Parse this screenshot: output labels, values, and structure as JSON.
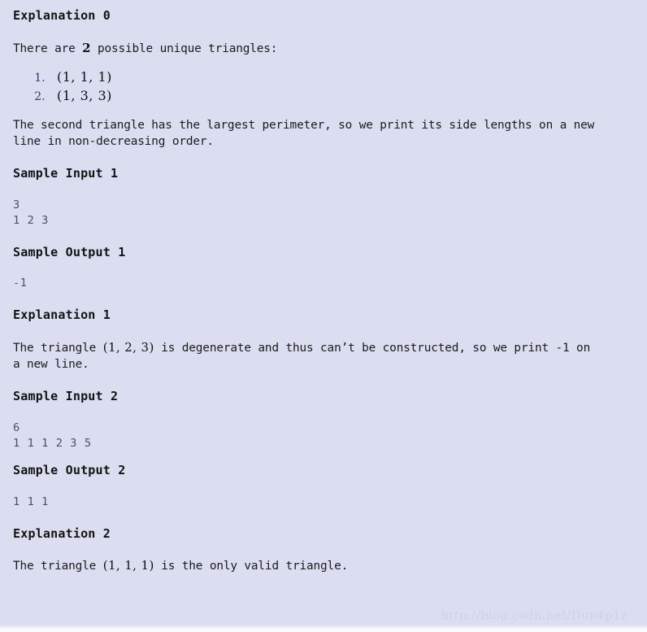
{
  "page": {
    "background_color": "#dbdef0",
    "text_color": "#1b1b1b",
    "code_color": "#4a4f63",
    "watermark_color": "#cfd2e4"
  },
  "sections": {
    "explanation0": {
      "heading": "Explanation 0",
      "intro_before": "There are ",
      "intro_count": "2",
      "intro_after": " possible unique triangles:",
      "triangles": [
        {
          "marker": "1.",
          "value": "(1, 1, 1)"
        },
        {
          "marker": "2.",
          "value": "(1, 3, 3)"
        }
      ],
      "body_line1": "The second triangle has the largest perimeter, so we print its side lengths on a new",
      "body_line2": "line in non-decreasing order."
    },
    "sample_input_1": {
      "heading": "Sample Input 1",
      "code": "3\n1 2 3"
    },
    "sample_output_1": {
      "heading": "Sample Output 1",
      "code": "-1"
    },
    "explanation1": {
      "heading": "Explanation 1",
      "body_before": "The triangle ",
      "body_tuple": "(1, 2, 3)",
      "body_after": " is degenerate and thus can’t be constructed, so we print -1 on",
      "body_line2": "a new line."
    },
    "sample_input_2": {
      "heading": "Sample Input 2",
      "code": "6\n1 1 1 2 3 5"
    },
    "sample_output_2": {
      "heading": "Sample Output 2",
      "code": "1 1 1"
    },
    "explanation2": {
      "heading": "Explanation 2",
      "body_before": "The triangle ",
      "body_tuple": "(1, 1, 1)",
      "body_after": " is the only valid triangle."
    }
  },
  "watermark": {
    "text": "http://blog.csdn.net/Dup4p1z"
  }
}
